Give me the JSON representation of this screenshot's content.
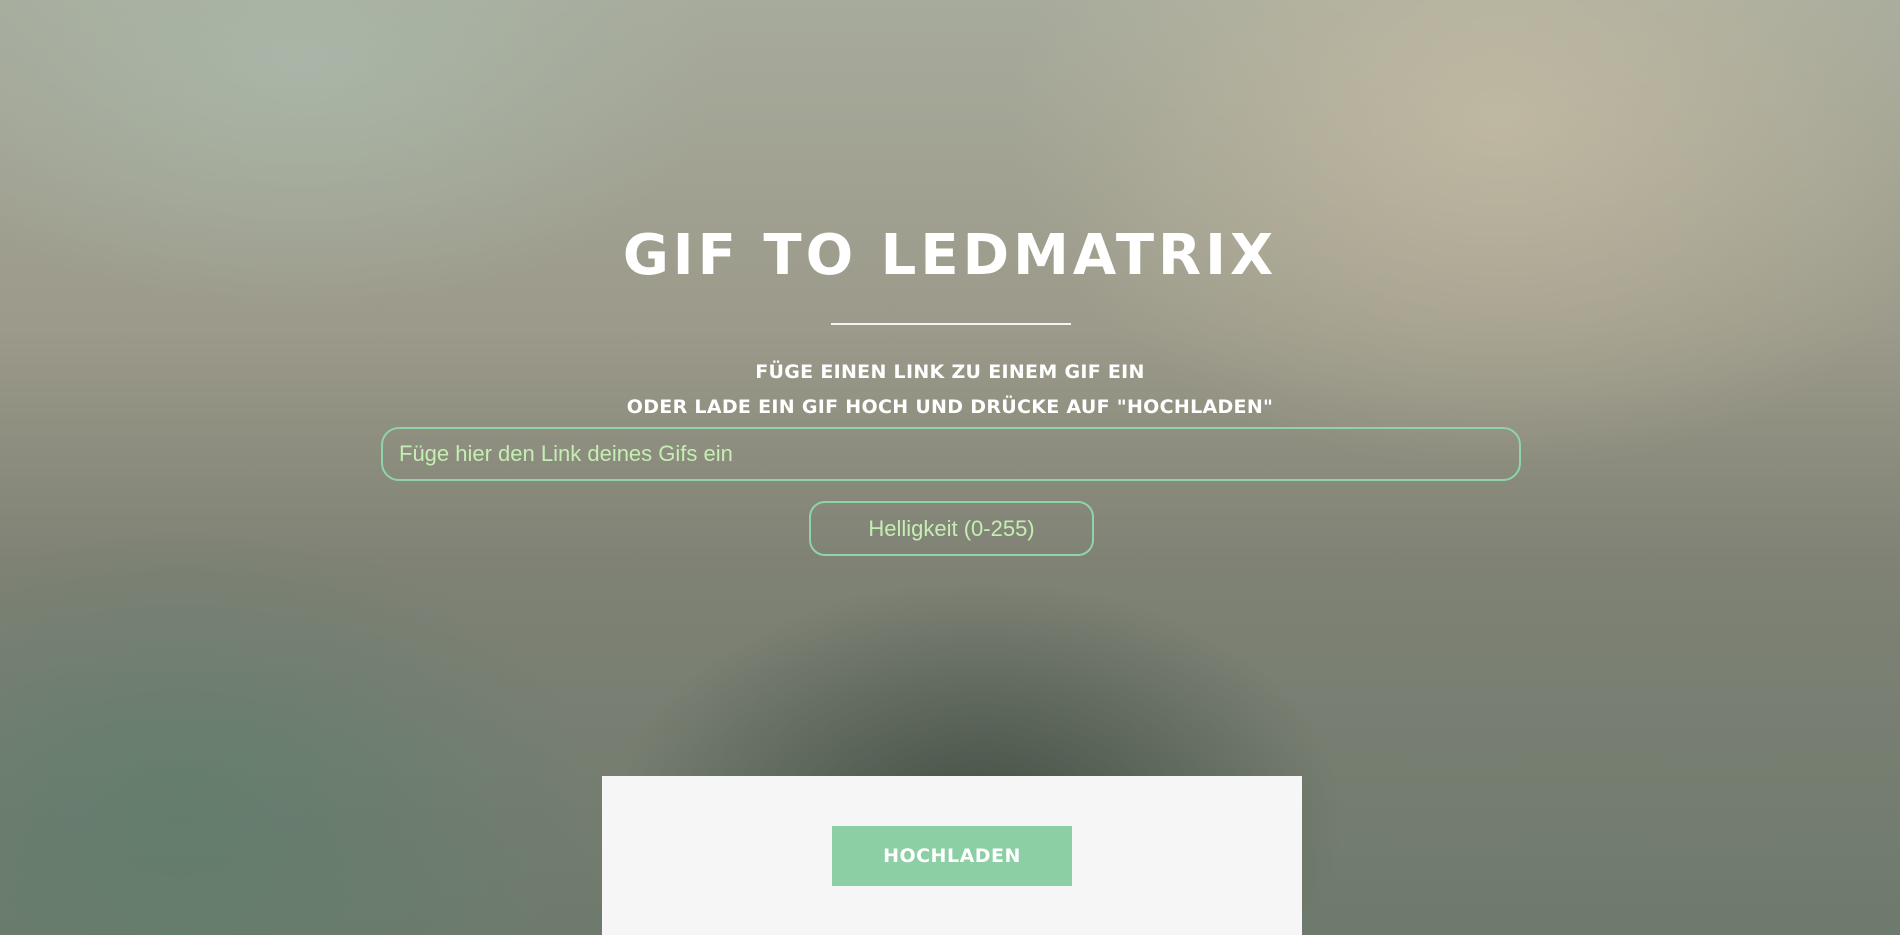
{
  "hero": {
    "title": "GIF TO LEDMATRIX",
    "subtitle_line1": "FÜGE EINEN LINK ZU EINEM GIF EIN",
    "subtitle_line2": "ODER LADE EIN GIF HOCH UND DRÜCKE AUF \"HOCHLADEN\""
  },
  "form": {
    "link_placeholder": "Füge hier den Link deines Gifs ein",
    "link_value": "",
    "brightness_placeholder": "Helligkeit (0-255)",
    "brightness_value": ""
  },
  "upload_panel": {
    "button_label": "HOCHLADEN"
  },
  "colors": {
    "accent": "#8ccfa4",
    "input_border": "#8fd4a8",
    "input_text": "#c4eeb2",
    "title_text": "#ffffff",
    "panel_background": "#f6f6f6"
  }
}
